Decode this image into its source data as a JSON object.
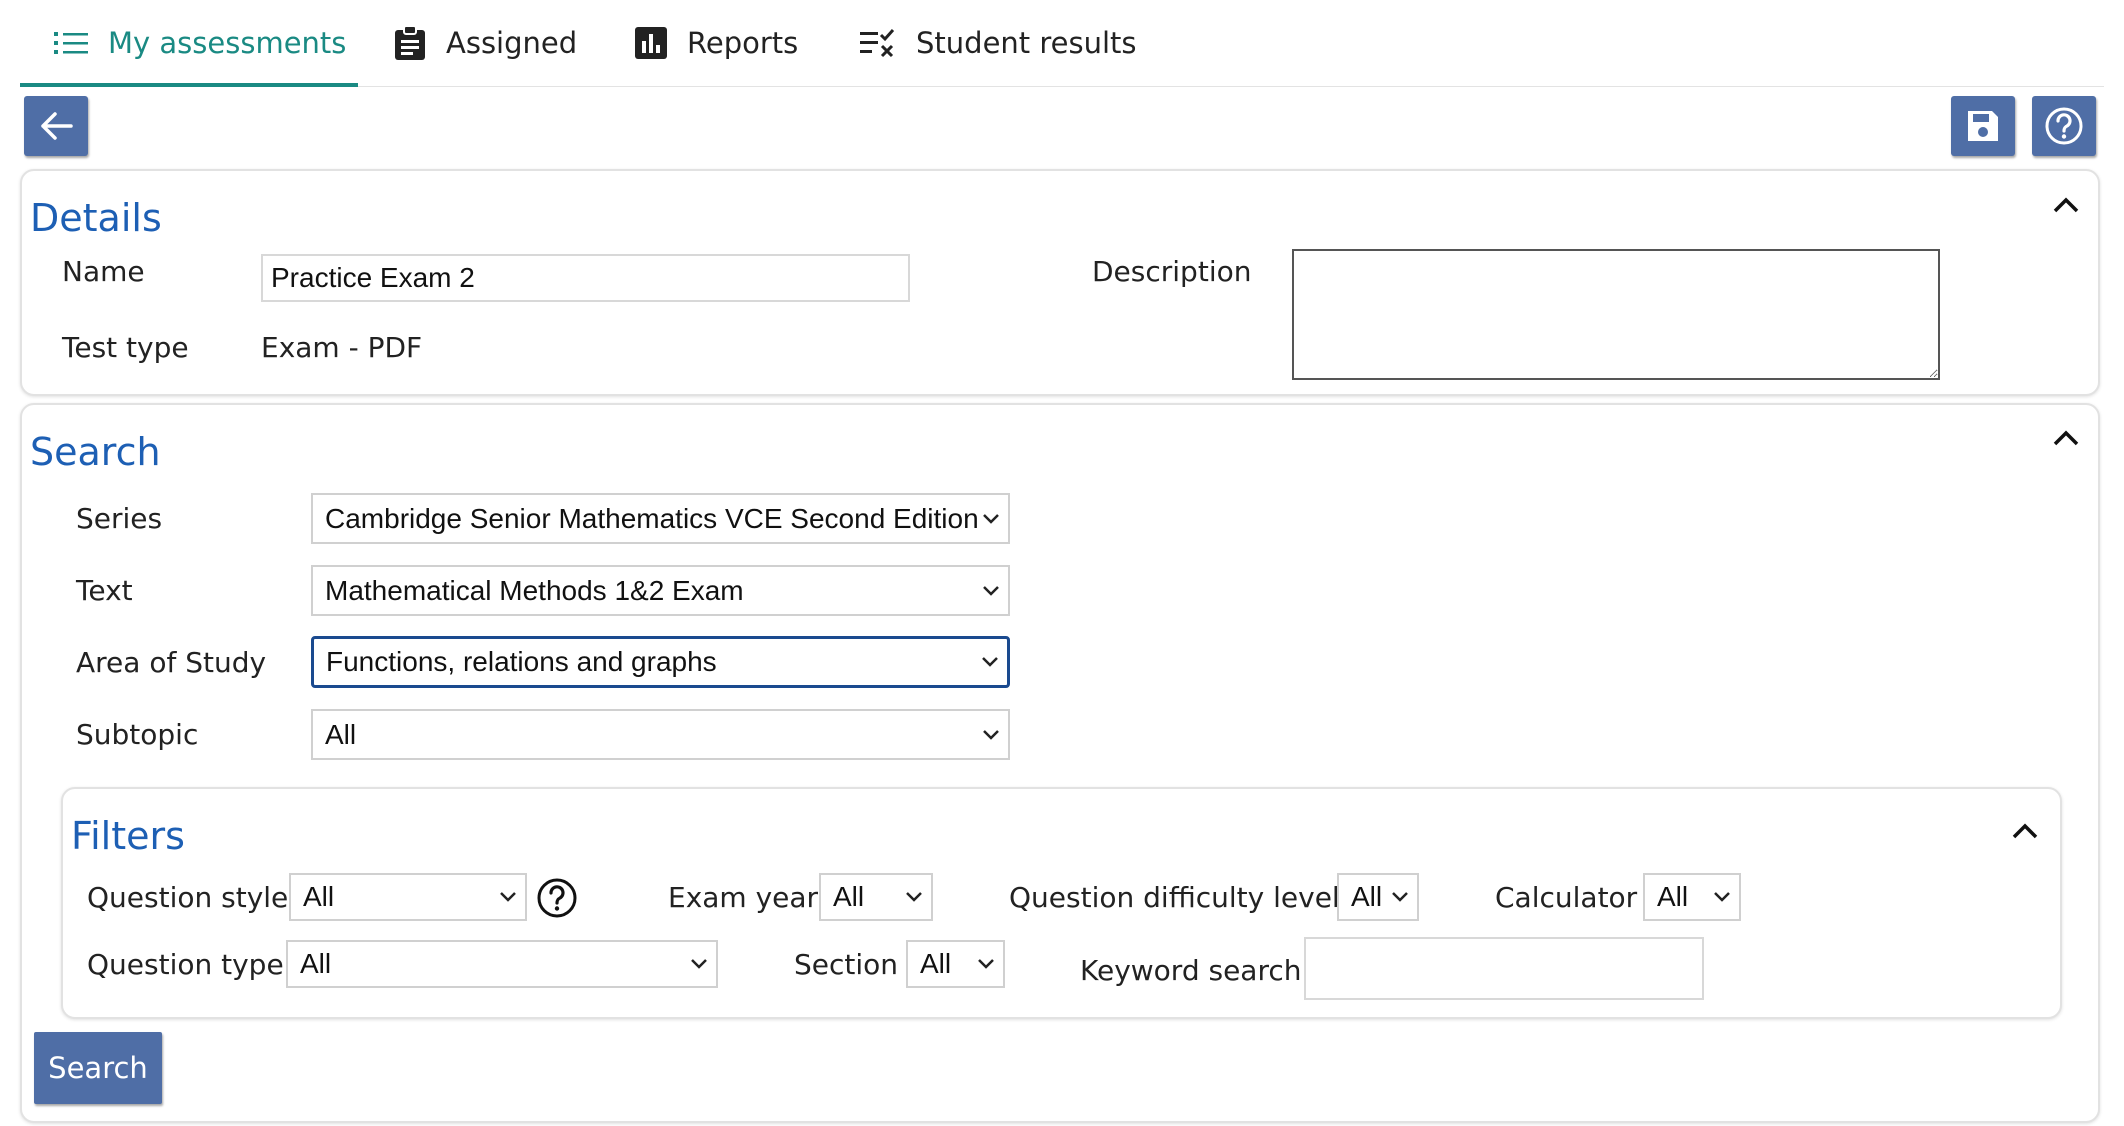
{
  "tabs": [
    {
      "label": "My assessments",
      "icon": "list-icon",
      "active": true
    },
    {
      "label": "Assigned",
      "icon": "clipboard-icon"
    },
    {
      "label": "Reports",
      "icon": "bar-chart-icon"
    },
    {
      "label": "Student results",
      "icon": "checklist-icon"
    }
  ],
  "toolbar": {
    "back": "back-arrow-icon",
    "save": "save-icon",
    "help": "help-icon"
  },
  "details": {
    "title": "Details",
    "name_label": "Name",
    "name_value": "Practice Exam 2",
    "test_type_label": "Test type",
    "test_type_value": "Exam - PDF",
    "description_label": "Description",
    "description_value": ""
  },
  "search": {
    "title": "Search",
    "series_label": "Series",
    "series_value": "Cambridge Senior Mathematics VCE Second Edition",
    "text_label": "Text",
    "text_value": "Mathematical Methods 1&2 Exam",
    "area_label": "Area of Study",
    "area_value": "Functions, relations and graphs",
    "subtopic_label": "Subtopic",
    "subtopic_value": "All"
  },
  "filters": {
    "title": "Filters",
    "question_style_label": "Question style",
    "question_style_value": "All",
    "exam_year_label": "Exam year",
    "exam_year_value": "All",
    "difficulty_label": "Question difficulty level",
    "difficulty_value": "All",
    "calculator_label": "Calculator",
    "calculator_value": "All",
    "question_type_label": "Question type",
    "question_type_value": "All",
    "section_label": "Section",
    "section_value": "All",
    "keyword_label": "Keyword search",
    "keyword_value": ""
  },
  "search_button": "Search",
  "colors": {
    "accent": "#1a8a83",
    "heading": "#1d5fb4",
    "button": "#4f6ea6"
  }
}
